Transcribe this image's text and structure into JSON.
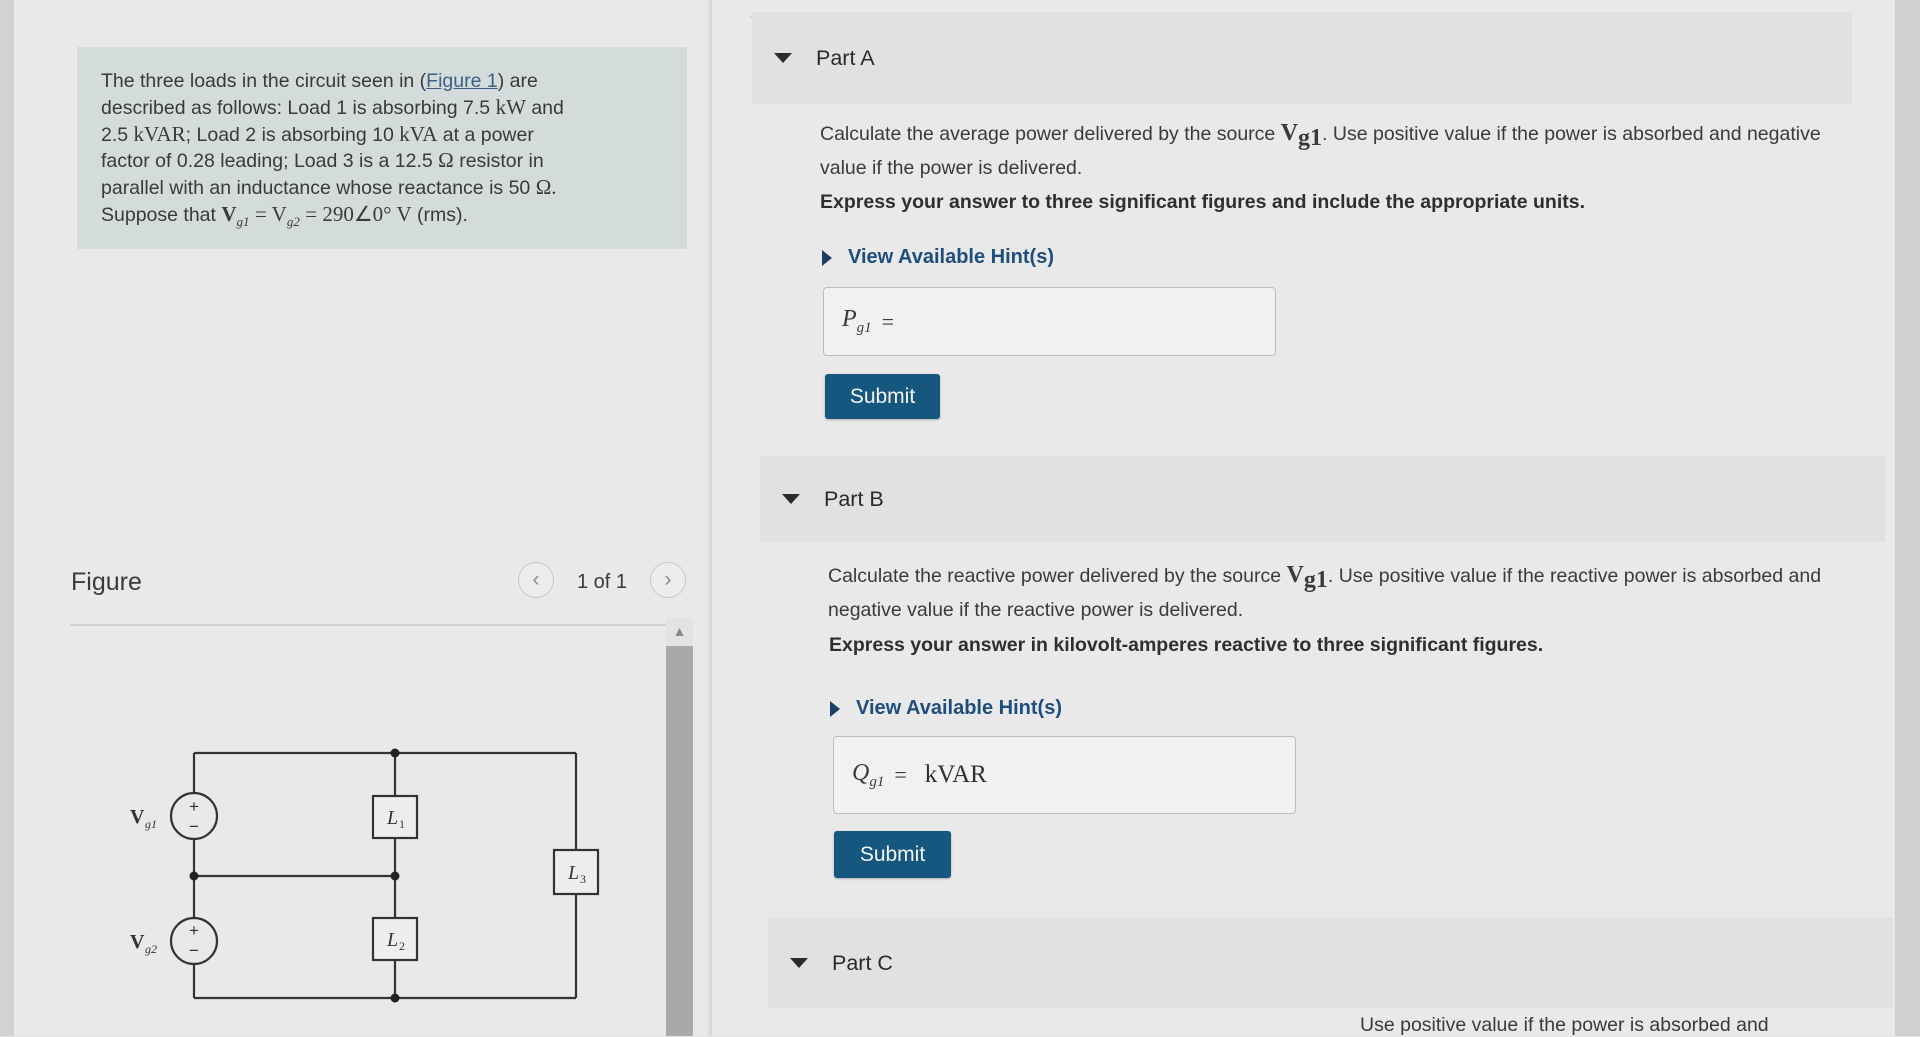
{
  "problem": {
    "text_1": "The three loads in the circuit seen in (",
    "figure_link": "Figure 1",
    "text_2": ") are",
    "line_2a": "described as follows: Load 1 is absorbing 7.5",
    "line_2b": "kW",
    "line_2c": "and",
    "line_3a": "2.5",
    "line_3b": "kVAR",
    "line_3c": "; Load 2 is absorbing 10",
    "line_3d": "kVA",
    "line_3e": "at a power",
    "line_4a": "factor of 0.28 leading; Load 3 is a 12.5",
    "line_4b": "Ω",
    "line_4c": "resistor in",
    "line_5a": "parallel with an inductance whose reactance is 50",
    "line_5b": "Ω.",
    "line_6a": "Suppose that",
    "line_6b": "V",
    "line_6c": "g1",
    "line_6d": "= V",
    "line_6e": "g2",
    "line_6f": "= 290∠0° V",
    "line_6g": "(rms)."
  },
  "figure": {
    "label": "Figure",
    "page_counter": "1 of 1",
    "prev_icon": "chevron-left-icon",
    "next_icon": "chevron-right-icon",
    "circuit": {
      "vg1_label": "V",
      "vg1_sub": "g1",
      "vg2_label": "V",
      "vg2_sub": "g2",
      "l1": "L",
      "l1_sub": "1",
      "l2": "L",
      "l2_sub": "2",
      "l3": "L",
      "l3_sub": "3",
      "plus": "+",
      "minus": "−"
    }
  },
  "partA": {
    "title": "Part A",
    "question_a": "Calculate the average power delivered by the source",
    "question_sym": "V",
    "question_sub": "g1",
    "question_b": ". Use positive value if the power is absorbed and negative value if the power is delivered.",
    "instruction": "Express your answer to three significant figures and include the appropriate units.",
    "hint": "View Available Hint(s)",
    "answer_label": "P",
    "answer_sub": "g1",
    "answer_eq": "=",
    "answer_value": "",
    "submit": "Submit"
  },
  "partB": {
    "title": "Part B",
    "question_a": "Calculate the reactive power delivered by the source",
    "question_sym": "V",
    "question_sub": "g1",
    "question_b": ". Use positive value if the reactive power is absorbed and negative value if the reactive power is delivered.",
    "instruction": "Express your answer in kilovolt-amperes reactive to three significant figures.",
    "hint": "View Available Hint(s)",
    "answer_label": "Q",
    "answer_sub": "g1",
    "answer_eq": "=",
    "answer_unit": "kVAR",
    "submit": "Submit"
  },
  "partC": {
    "title": "Part C",
    "question_partial": "Use positive value if the power is absorbed and"
  }
}
